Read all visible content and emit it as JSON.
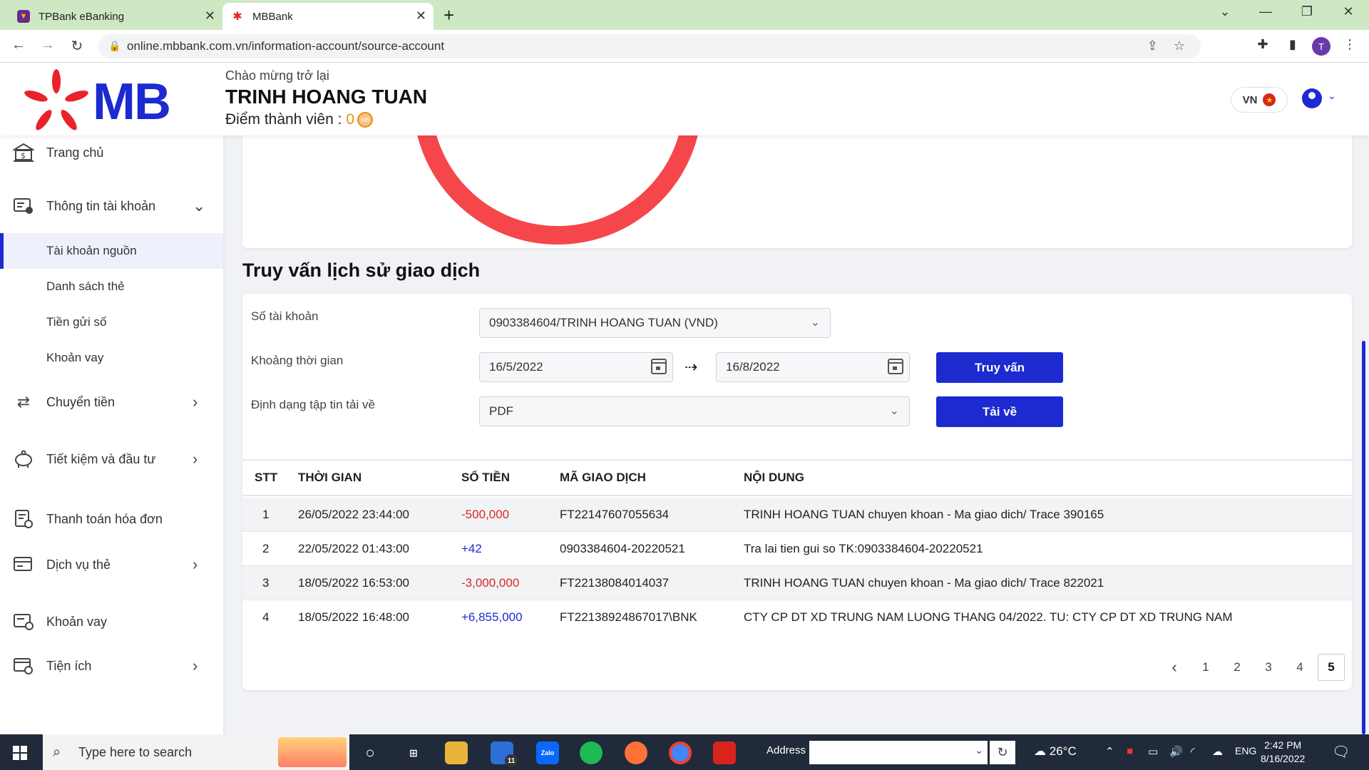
{
  "browser": {
    "tabs": [
      {
        "title": "TPBank eBanking",
        "active": false
      },
      {
        "title": "MBBank",
        "active": true
      }
    ],
    "url": "online.mbbank.com.vn/information-account/source-account",
    "profile_initial": "T"
  },
  "header": {
    "logo_text": "MB",
    "greeting": "Chào mừng trở lại",
    "user_name": "TRINH HOANG TUAN",
    "points_label": "Điểm thành viên :",
    "points_value": "0",
    "lang": "VN"
  },
  "sidebar": {
    "items": [
      {
        "label": "Trang chủ"
      },
      {
        "label": "Thông tin tài khoản"
      },
      {
        "label": "Chuyển tiền"
      },
      {
        "label": "Tiết kiệm và đầu tư"
      },
      {
        "label": "Thanh toán hóa đơn"
      },
      {
        "label": "Dịch vụ thẻ"
      },
      {
        "label": "Khoản vay"
      },
      {
        "label": "Tiện ích"
      }
    ],
    "subitems": [
      {
        "label": "Tài khoản nguồn",
        "active": true
      },
      {
        "label": "Danh sách thẻ"
      },
      {
        "label": "Tiền gửi số"
      },
      {
        "label": "Khoản vay"
      }
    ]
  },
  "query": {
    "title": "Truy vấn lịch sử giao dịch",
    "account_label": "Số tài khoản",
    "account_value": "0903384604/TRINH HOANG TUAN (VND)",
    "period_label": "Khoảng thời gian",
    "date_from": "16/5/2022",
    "date_to": "16/8/2022",
    "format_label": "Định dạng tập tin tải về",
    "format_value": "PDF",
    "query_button": "Truy vấn",
    "download_button": "Tải về"
  },
  "table": {
    "headers": [
      "STT",
      "THỜI GIAN",
      "SỐ TIỀN",
      "MÃ GIAO DỊCH",
      "NỘI DUNG"
    ],
    "rows": [
      {
        "stt": "1",
        "time": "26/05/2022 23:44:00",
        "amount": "-500,000",
        "code": "FT22147607055634",
        "content": "TRINH HOANG TUAN chuyen khoan - Ma giao dich/ Trace 390165"
      },
      {
        "stt": "2",
        "time": "22/05/2022 01:43:00",
        "amount": "+42",
        "code": "0903384604-20220521",
        "content": "Tra lai tien gui so TK:0903384604-20220521"
      },
      {
        "stt": "3",
        "time": "18/05/2022 16:53:00",
        "amount": "-3,000,000",
        "code": "FT22138084014037",
        "content": "TRINH HOANG TUAN chuyen khoan - Ma giao dich/ Trace 822021"
      },
      {
        "stt": "4",
        "time": "18/05/2022 16:48:00",
        "amount": "+6,855,000",
        "code": "FT22138924867017\\BNK",
        "content": "CTY CP DT XD TRUNG NAM LUONG THANG 04/2022. TU: CTY CP DT XD TRUNG NAM"
      }
    ]
  },
  "pagination": {
    "pages": [
      "1",
      "2",
      "3",
      "4",
      "5"
    ],
    "current": "5"
  },
  "taskbar": {
    "search_placeholder": "Type here to search",
    "mail_badge": "11",
    "address_label": "Address",
    "temperature": "26°C",
    "language": "ENG",
    "time": "2:42 PM",
    "date": "8/16/2022"
  },
  "colors": {
    "brand": "#1c2ad0",
    "negative": "#e02525",
    "positive": "#1c2ad0",
    "donut": "#f5474b"
  }
}
